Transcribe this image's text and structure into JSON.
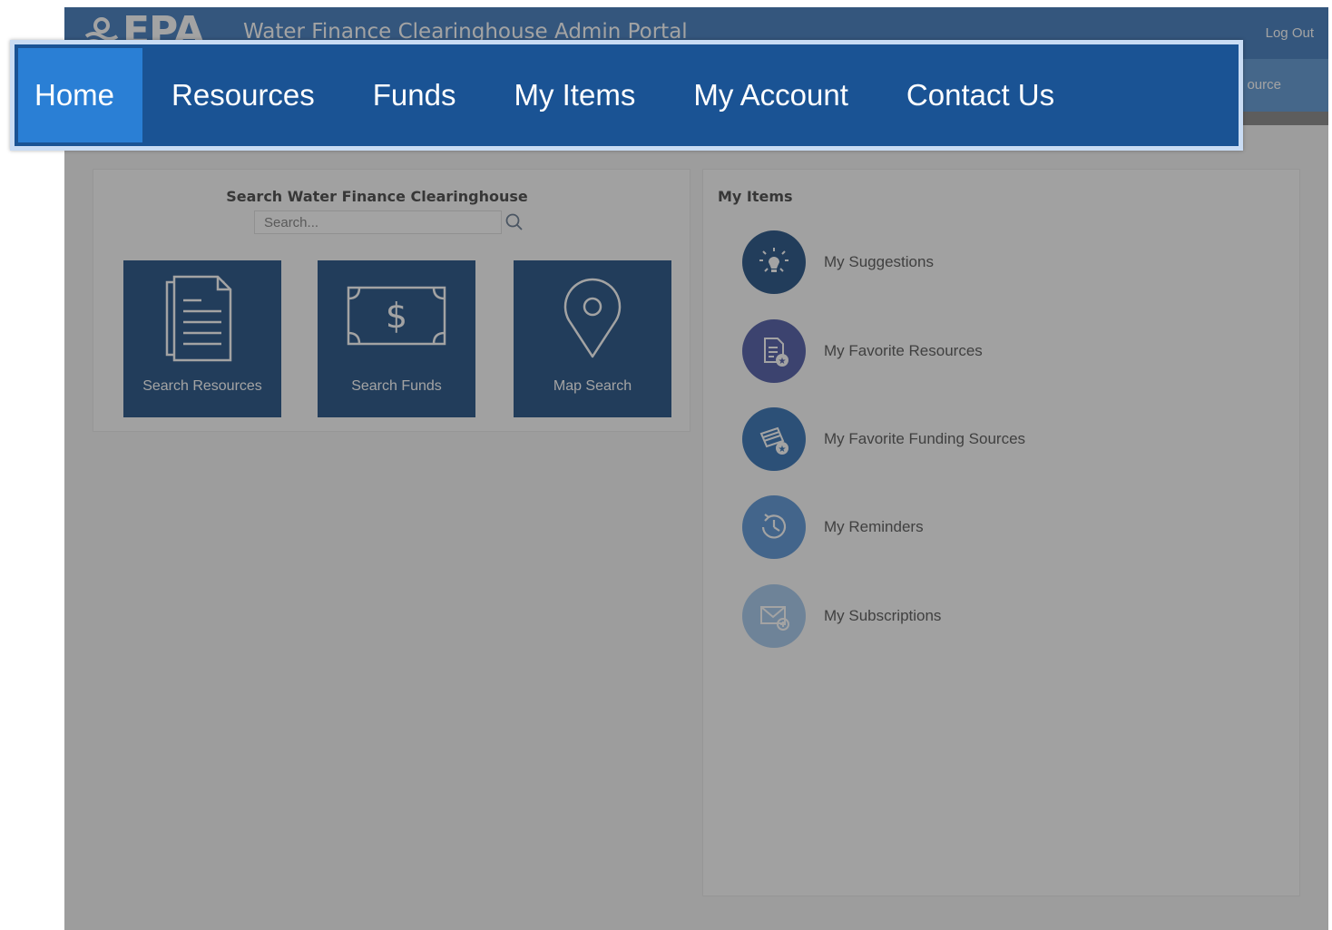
{
  "header": {
    "logo_text": "EPA",
    "portal_title": "Water Finance Clearinghouse Admin Portal",
    "logout_label": "Log Out",
    "sub_link_partial": "ource",
    "brand_color": "#2f6fb7"
  },
  "nav": {
    "items": [
      {
        "label": "Home",
        "active": true
      },
      {
        "label": "Resources",
        "active": false
      },
      {
        "label": "Funds",
        "active": false
      },
      {
        "label": "My Items",
        "active": false
      },
      {
        "label": "My Account",
        "active": false
      },
      {
        "label": "Contact Us",
        "active": false
      }
    ],
    "background": "#1a5394",
    "active_background": "#2a7fd5"
  },
  "search_panel": {
    "heading": "Search Water Finance Clearinghouse",
    "placeholder": "Search...",
    "search_icon": "search-icon",
    "tiles": [
      {
        "label": "Search Resources",
        "icon": "document-icon"
      },
      {
        "label": "Search Funds",
        "icon": "dollar-bill-icon"
      },
      {
        "label": "Map Search",
        "icon": "map-pin-icon"
      }
    ],
    "tile_color": "#0c3f78"
  },
  "items_panel": {
    "heading": "My Items",
    "items": [
      {
        "label": "My Suggestions",
        "icon": "lightbulb-icon",
        "color": "#0c3f78"
      },
      {
        "label": "My Favorite Resources",
        "icon": "favorite-document-icon",
        "color": "#3d4b9e"
      },
      {
        "label": "My Favorite Funding Sources",
        "icon": "favorite-money-icon",
        "color": "#1f63ad"
      },
      {
        "label": "My Reminders",
        "icon": "clock-reminder-icon",
        "color": "#4a8bd1"
      },
      {
        "label": "My Subscriptions",
        "icon": "envelope-add-icon",
        "color": "#9cc3ea"
      }
    ]
  }
}
